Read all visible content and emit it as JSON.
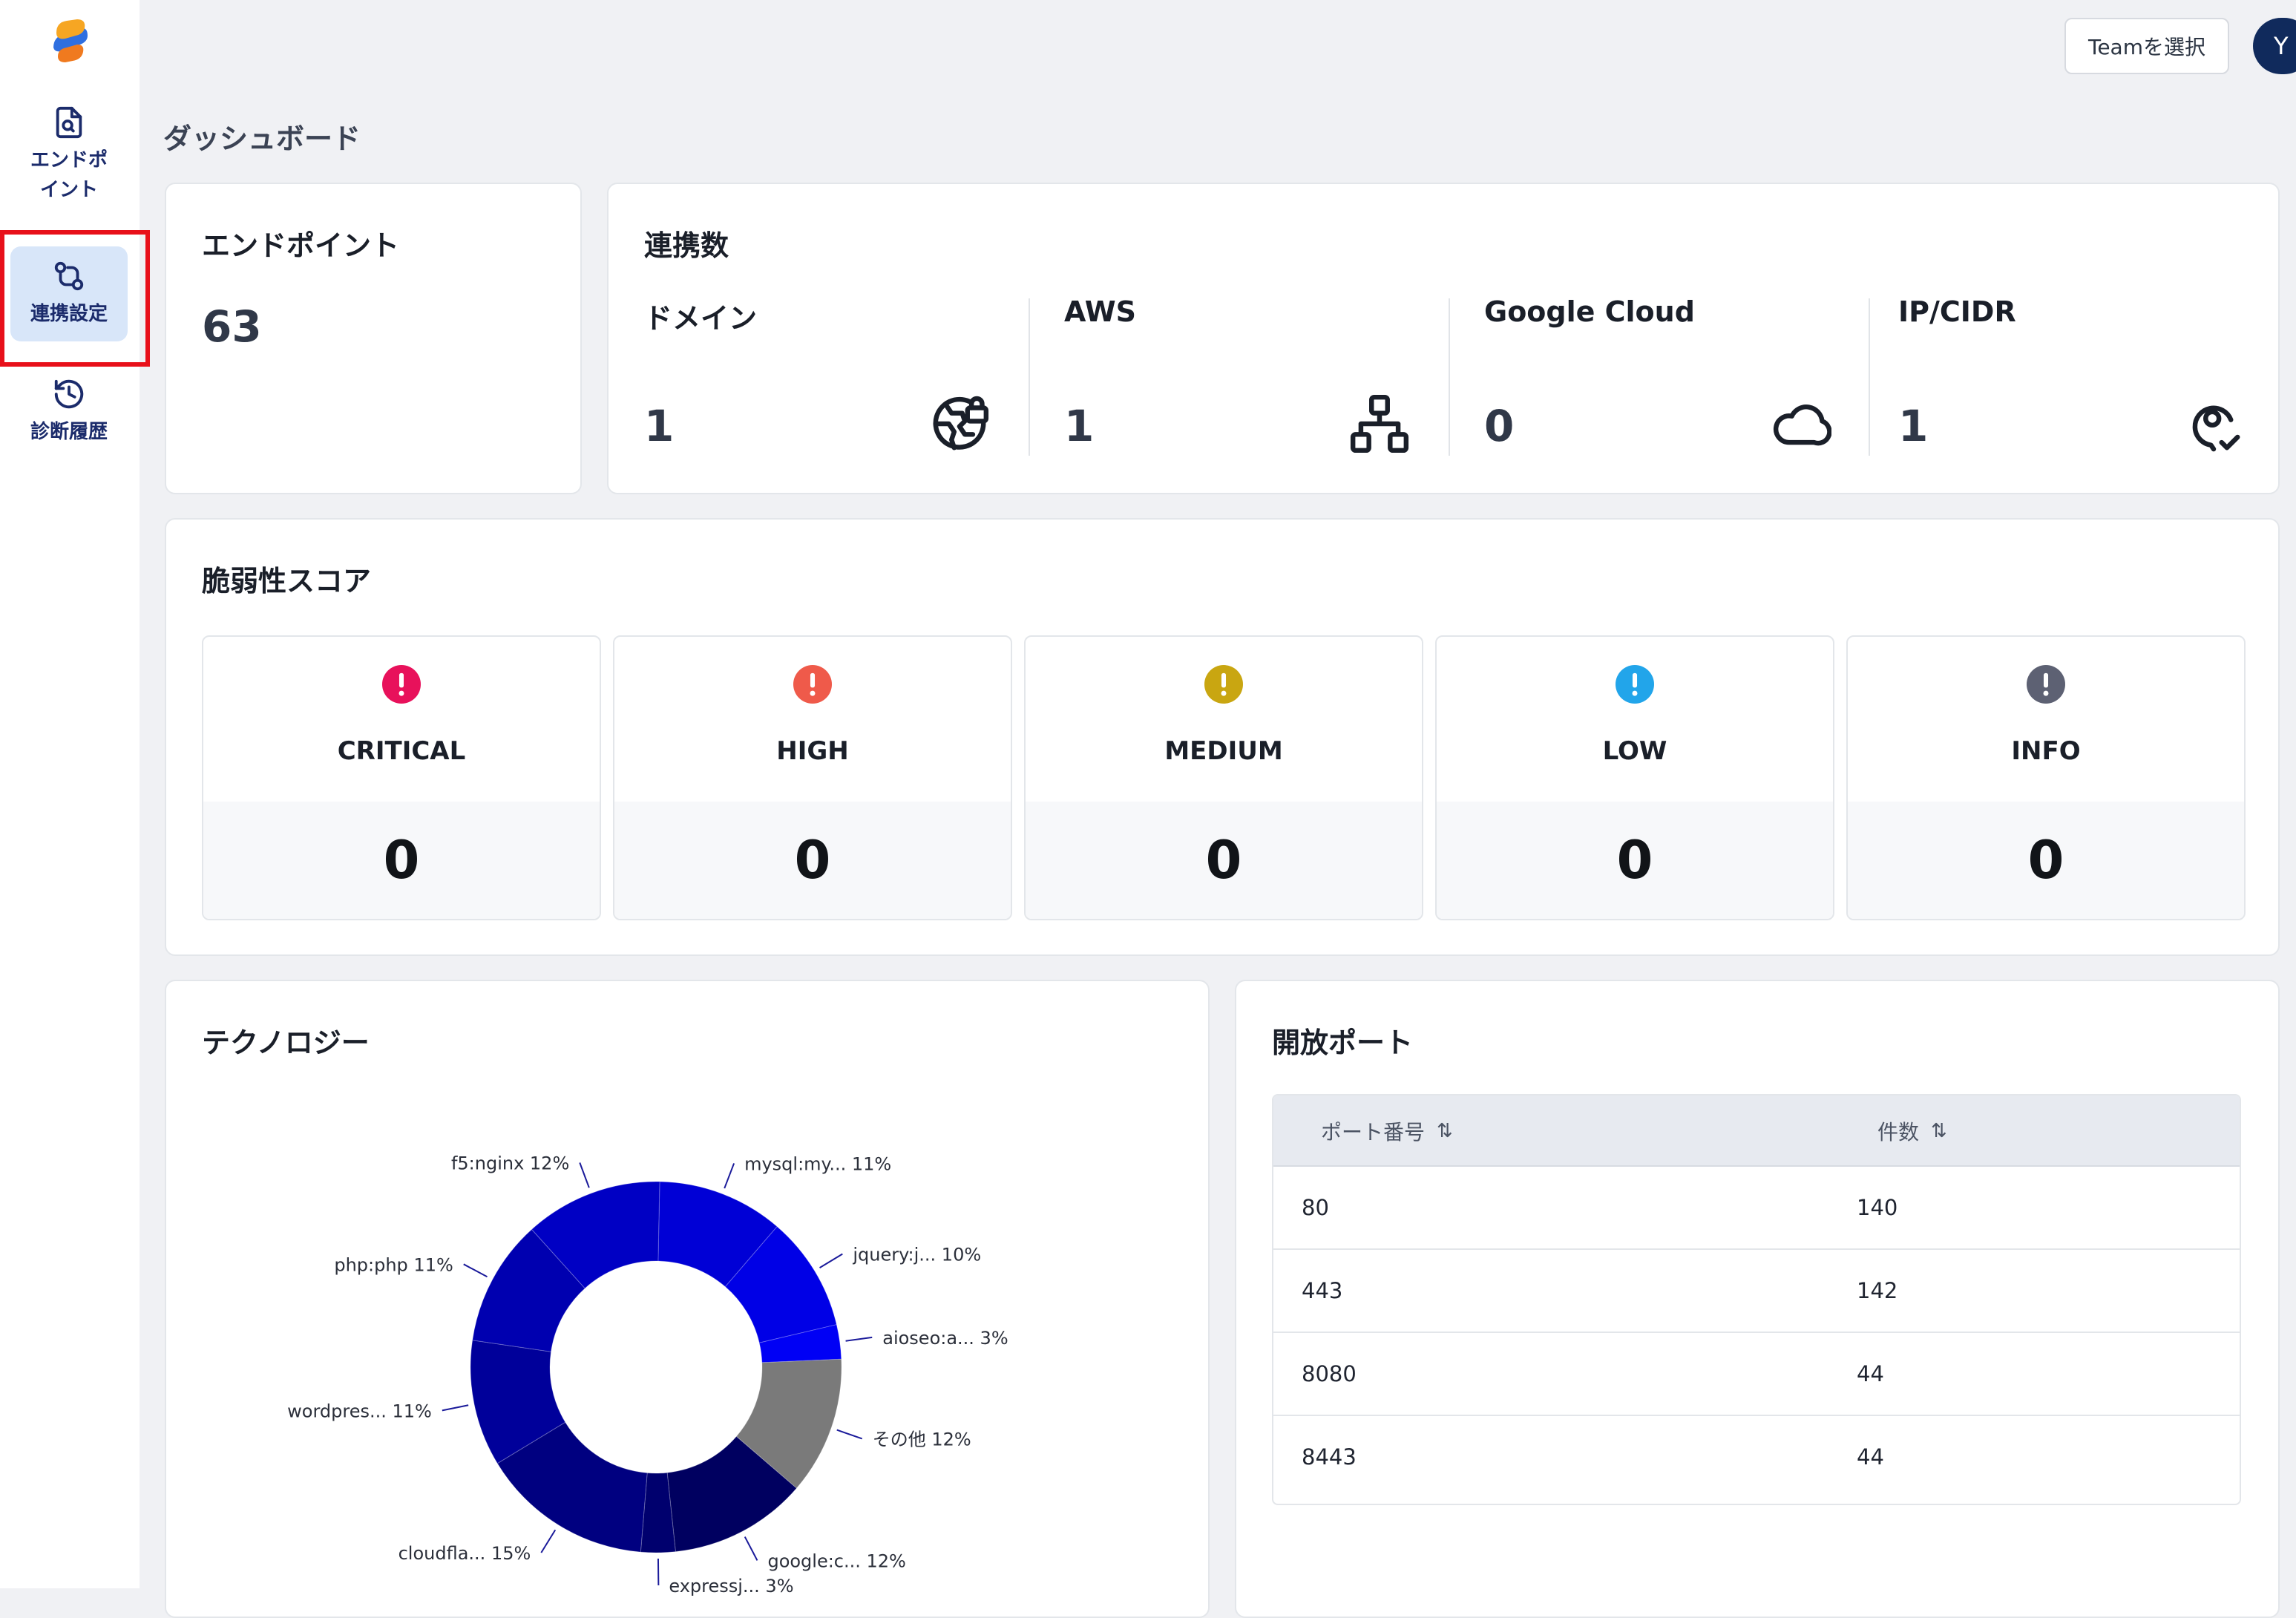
{
  "sidebar": {
    "items": [
      {
        "label": "エンドポイント"
      },
      {
        "label": "連携設定"
      },
      {
        "label": "診断履歴"
      }
    ]
  },
  "topbar": {
    "team_button": "Teamを選択",
    "avatar_initial": "Y"
  },
  "page": {
    "title": "ダッシュボード"
  },
  "endpoint_card": {
    "title": "エンドポイント",
    "count": "63"
  },
  "integration_card": {
    "title": "連携数",
    "columns": [
      {
        "label": "ドメイン",
        "value": "1",
        "icon": "globe-lock-icon"
      },
      {
        "label": "AWS",
        "value": "1",
        "icon": "network-icon"
      },
      {
        "label": "Google Cloud",
        "value": "0",
        "icon": "cloud-icon"
      },
      {
        "label": "IP/CIDR",
        "value": "1",
        "icon": "map-pin-check-icon"
      }
    ]
  },
  "vuln_card": {
    "title": "脆弱性スコア",
    "severities": [
      {
        "label": "CRITICAL",
        "count": "0",
        "color": "#e8115b"
      },
      {
        "label": "HIGH",
        "count": "0",
        "color": "#ef5a4a"
      },
      {
        "label": "MEDIUM",
        "count": "0",
        "color": "#c9a611"
      },
      {
        "label": "LOW",
        "count": "0",
        "color": "#22a5ea"
      },
      {
        "label": "INFO",
        "count": "0",
        "color": "#5d6173"
      }
    ]
  },
  "tech_card": {
    "title": "テクノロジー"
  },
  "chart_data": {
    "type": "pie",
    "donut": true,
    "slices": [
      {
        "label": "mysql:my... 11%",
        "value": 11,
        "color": "#0000d6"
      },
      {
        "label": "jquery:j... 10%",
        "value": 10,
        "color": "#0000e6"
      },
      {
        "label": "aioseo:a... 3%",
        "value": 3,
        "color": "#0000f5"
      },
      {
        "label": "その他 12%",
        "value": 12,
        "color": "#7a7a7a"
      },
      {
        "label": "google:c... 12%",
        "value": 12,
        "color": "#000060"
      },
      {
        "label": "expressj... 3%",
        "value": 3,
        "color": "#00006e"
      },
      {
        "label": "cloudfla... 15%",
        "value": 15,
        "color": "#000080"
      },
      {
        "label": "wordpres... 11%",
        "value": 11,
        "color": "#00009a"
      },
      {
        "label": "php:php 11%",
        "value": 11,
        "color": "#0000b0"
      },
      {
        "label": "f5:nginx 12%",
        "value": 12,
        "color": "#0000c4"
      }
    ]
  },
  "ports_card": {
    "title": "開放ポート",
    "headers": [
      "ポート番号",
      "件数"
    ],
    "sort_glyph": "⇅",
    "rows": [
      {
        "port": "80",
        "count": "140"
      },
      {
        "port": "443",
        "count": "142"
      },
      {
        "port": "8080",
        "count": "44"
      },
      {
        "port": "8443",
        "count": "44"
      }
    ]
  }
}
